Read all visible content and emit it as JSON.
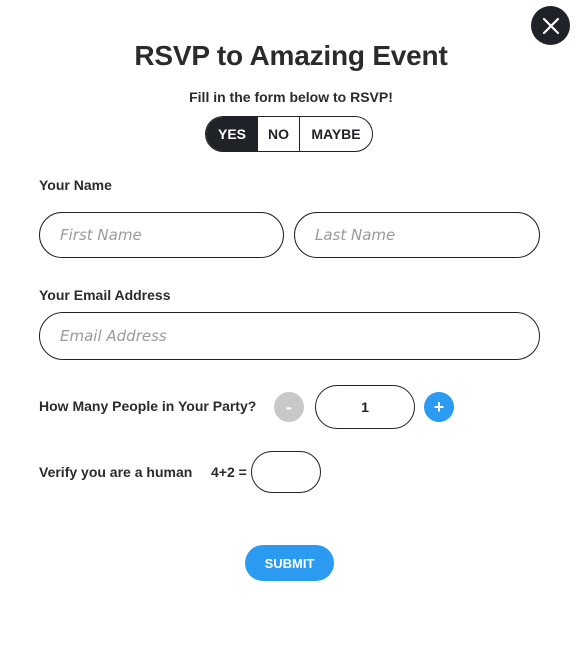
{
  "modal": {
    "title": "RSVP to Amazing Event",
    "subtitle": "Fill in the form below to RSVP!",
    "close_icon": "close-icon"
  },
  "rsvp_options": {
    "yes": "YES",
    "no": "NO",
    "maybe": "MAYBE",
    "selected": "YES"
  },
  "name_section": {
    "label": "Your Name",
    "first_name_placeholder": "First Name",
    "last_name_placeholder": "Last Name"
  },
  "email_section": {
    "label": "Your Email Address",
    "placeholder": "Email Address"
  },
  "party_section": {
    "label": "How Many People in Your Party?",
    "minus_label": "-",
    "plus_label": "+",
    "count": "1"
  },
  "captcha": {
    "label": "Verify you are a human",
    "question": "4+2 ="
  },
  "submit_label": "SUBMIT",
  "colors": {
    "accent": "#2a9bf0",
    "dark": "#1f2226",
    "disabled": "#c8c8c8"
  }
}
